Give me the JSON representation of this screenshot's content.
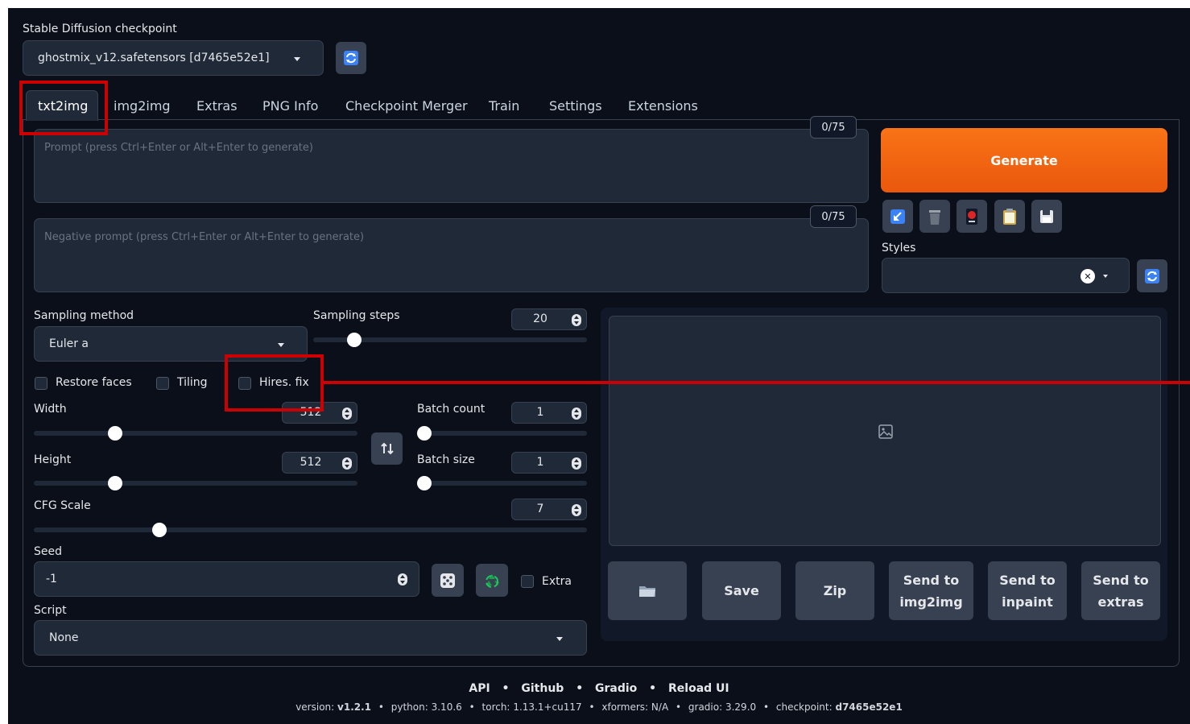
{
  "checkpoint": {
    "label": "Stable Diffusion checkpoint",
    "selected": "ghostmix_v12.safetensors [d7465e52e1]"
  },
  "tabs": [
    "txt2img",
    "img2img",
    "Extras",
    "PNG Info",
    "Checkpoint Merger",
    "Train",
    "Settings",
    "Extensions"
  ],
  "prompt": {
    "placeholder": "Prompt (press Ctrl+Enter or Alt+Enter to generate)",
    "counter": "0/75"
  },
  "negative_prompt": {
    "placeholder": "Negative prompt (press Ctrl+Enter or Alt+Enter to generate)",
    "counter": "0/75"
  },
  "generate_label": "Generate",
  "styles": {
    "label": "Styles",
    "clear_symbol": "✕"
  },
  "sampling_method": {
    "label": "Sampling method",
    "value": "Euler a"
  },
  "sampling_steps": {
    "label": "Sampling steps",
    "value": "20",
    "slider_fraction": 0.13
  },
  "checkboxes": {
    "restore_faces": "Restore faces",
    "tiling": "Tiling",
    "hires_fix": "Hires. fix"
  },
  "width": {
    "label": "Width",
    "value": "512",
    "slider_fraction": 0.24
  },
  "height": {
    "label": "Height",
    "value": "512",
    "slider_fraction": 0.24
  },
  "batch_count": {
    "label": "Batch count",
    "value": "1",
    "slider_fraction": 0.0
  },
  "batch_size": {
    "label": "Batch size",
    "value": "1",
    "slider_fraction": 0.0
  },
  "cfg_scale": {
    "label": "CFG Scale",
    "value": "7",
    "slider_fraction": 0.22
  },
  "seed": {
    "label": "Seed",
    "value": "-1",
    "extra_label": "Extra"
  },
  "script": {
    "label": "Script",
    "value": "None"
  },
  "output_buttons": {
    "save": "Save",
    "zip": "Zip",
    "send_img2img": [
      "Send to",
      "img2img"
    ],
    "send_inpaint": [
      "Send to",
      "inpaint"
    ],
    "send_extras": [
      "Send to",
      "extras"
    ]
  },
  "footer": {
    "links": [
      "API",
      "Github",
      "Gradio",
      "Reload UI"
    ],
    "separator": "•",
    "versions": [
      {
        "k": "version:",
        "v": "v1.2.1"
      },
      {
        "k": "python:",
        "v": "3.10.6"
      },
      {
        "k": "torch:",
        "v": "1.13.1+cu117"
      },
      {
        "k": "xformers:",
        "v": "N/A"
      },
      {
        "k": "gradio:",
        "v": "3.29.0"
      },
      {
        "k": "checkpoint:",
        "v": "d7465e52e1"
      }
    ]
  },
  "colors": {
    "background": "#0b0f19",
    "panel": "#1f2937",
    "generate_orange": "#f97316",
    "highlight_red": "#cc0000"
  },
  "icons": {
    "refresh": "refresh-icon",
    "paste": "arrow-icon",
    "trash": "trash-icon",
    "extra_networks": "red-card-icon",
    "clipboard": "clipboard-icon",
    "save_style": "floppy-icon",
    "dice": "dice-icon",
    "recycle": "recycle-icon",
    "swap": "swap-icon",
    "folder": "folder-icon",
    "image_placeholder": "image-icon"
  }
}
